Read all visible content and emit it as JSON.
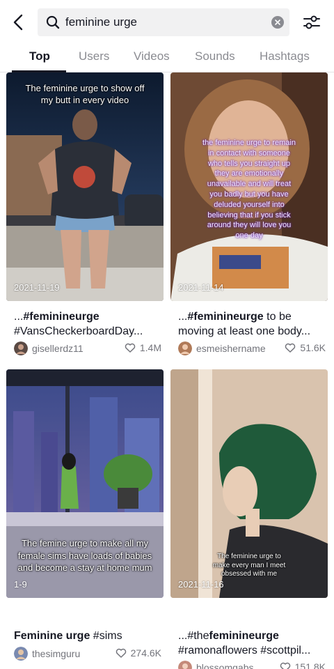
{
  "search": {
    "query": "feminine urge"
  },
  "tabs": [
    "Top",
    "Users",
    "Videos",
    "Sounds",
    "Hashtags"
  ],
  "cards": [
    {
      "caption": "The feminine urge to show off my butt in every video",
      "date": "2021-11-19",
      "desc_prefix": "...",
      "desc_bold": "#feminineurge",
      "desc_rest": "",
      "desc_line2": "#VansCheckerboardDay...",
      "username": "gisellerdz11",
      "likes": "1.4M"
    },
    {
      "caption": "the feminine urge to remain in contact with someone who tells you straight up they are emotionally unavailable and will treat you badly but you have deluded yourself into believing that if you stick around they will love you one day",
      "date": "2021-11-14",
      "desc_prefix": "...",
      "desc_bold": "#feminineurge",
      "desc_rest": " to be",
      "desc_line2": "moving at least one body...",
      "username": "esmeishername",
      "likes": "51.6K"
    },
    {
      "caption": "The femine urge to make all my female sims have loads of babies and become a stay at home mum",
      "date": "1-9",
      "desc_prefix": "",
      "desc_bold": "Feminine urge",
      "desc_rest": " #sims",
      "desc_line2": "",
      "username": "thesimguru",
      "likes": "274.6K"
    },
    {
      "caption": "The feminine urge to make every man I meet obsessed with me",
      "date": "2021-11-16",
      "desc_prefix": "...#the",
      "desc_bold": "feminineurge",
      "desc_rest": "",
      "desc_line2": "#ramonaflowers #scottpil...",
      "username": "blossomgabs",
      "likes": "151.8K"
    }
  ],
  "colors": {
    "text_primary": "#161823",
    "text_secondary": "#8a8b91",
    "search_bg": "#f1f1f2"
  }
}
